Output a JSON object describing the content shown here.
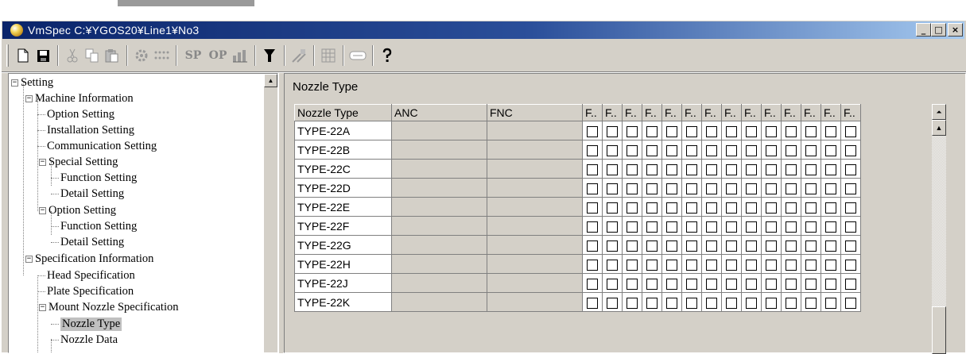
{
  "window": {
    "title": "VmSpec C:¥YGOS20¥Line1¥No3",
    "minimize": "_",
    "maximize": "□",
    "close": "×"
  },
  "toolbar": {
    "icons": [
      "new-file-icon",
      "save-icon",
      "cut-icon",
      "copy-icon",
      "paste-icon",
      "gear-icon",
      "dots-icon",
      "sp-text",
      "op-text",
      "chart-icon",
      "filter-icon",
      "tools-icon",
      "grid-icon",
      "tag-icon",
      "help-icon"
    ],
    "sp_label": "SP",
    "op_label": "OP"
  },
  "tree": {
    "items": [
      {
        "label": "Setting",
        "expander": "−"
      },
      {
        "label": "Machine Information",
        "expander": "−"
      },
      {
        "label": "Option Setting"
      },
      {
        "label": "Installation Setting"
      },
      {
        "label": "Communication Setting"
      },
      {
        "label": "Special Setting",
        "expander": "−"
      },
      {
        "label": "Function Setting"
      },
      {
        "label": "Detail Setting"
      },
      {
        "label": "Option Setting",
        "expander": "−"
      },
      {
        "label": "Function Setting"
      },
      {
        "label": "Detail Setting"
      },
      {
        "label": "Specification Information",
        "expander": "−"
      },
      {
        "label": "Head Specification"
      },
      {
        "label": "Plate Specification"
      },
      {
        "label": "Mount Nozzle Specification",
        "expander": "−"
      },
      {
        "label": "Nozzle Type",
        "selected": true
      },
      {
        "label": "Nozzle Data"
      }
    ]
  },
  "panel": {
    "title": "Nozzle Type",
    "columns": [
      "Nozzle Type",
      "ANC",
      "FNC",
      "F..",
      "F..",
      "F..",
      "F..",
      "F..",
      "F..",
      "F..",
      "F..",
      "F..",
      "F..",
      "F..",
      "F..",
      "F..",
      "F.."
    ],
    "rows": [
      {
        "type": "TYPE-22A"
      },
      {
        "type": "TYPE-22B"
      },
      {
        "type": "TYPE-22C"
      },
      {
        "type": "TYPE-22D"
      },
      {
        "type": "TYPE-22E"
      },
      {
        "type": "TYPE-22F"
      },
      {
        "type": "TYPE-22G"
      },
      {
        "type": "TYPE-22H"
      },
      {
        "type": "TYPE-22J"
      },
      {
        "type": "TYPE-22K"
      }
    ]
  }
}
